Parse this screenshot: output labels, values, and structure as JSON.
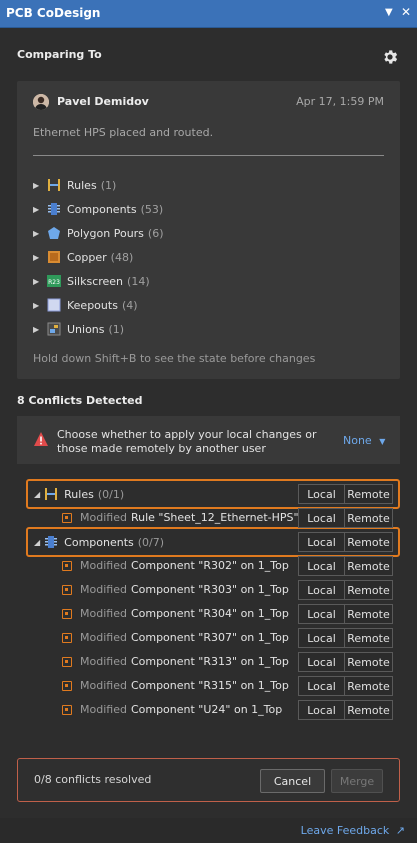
{
  "window": {
    "title": "PCB CoDesign",
    "dropdown_icon": "chevron-down-icon",
    "close_icon": "close-icon"
  },
  "comparing": {
    "heading": "Comparing To",
    "settings_icon": "gear-icon",
    "author": "Pavel Demidov",
    "date": "Apr 17, 1:59 PM",
    "comment": "Ethernet HPS placed and routed.",
    "tree": [
      {
        "label": "Rules",
        "count": "(1)",
        "icon": "rules-icon"
      },
      {
        "label": "Components",
        "count": "(53)",
        "icon": "component-icon"
      },
      {
        "label": "Polygon Pours",
        "count": "(6)",
        "icon": "polygon-icon"
      },
      {
        "label": "Copper",
        "count": "(48)",
        "icon": "copper-icon"
      },
      {
        "label": "Silkscreen",
        "count": "(14)",
        "icon": "silkscreen-icon"
      },
      {
        "label": "Keepouts",
        "count": "(4)",
        "icon": "keepout-icon"
      },
      {
        "label": "Unions",
        "count": "(1)",
        "icon": "union-icon"
      }
    ],
    "hint": "Hold down Shift+B to see the state before changes"
  },
  "conflicts": {
    "heading": "8 Conflicts Detected",
    "info": "Choose whether to apply your local changes or those made remotely by another user",
    "apply_option": "None",
    "local_label": "Local",
    "remote_label": "Remote",
    "groups": [
      {
        "label": "Rules",
        "count": "(0/1)",
        "items": [
          {
            "modified": "Modified",
            "object": "Rule \"Sheet_12_Ethernet-HPS\""
          }
        ]
      },
      {
        "label": "Components",
        "count": "(0/7)",
        "items": [
          {
            "modified": "Modified",
            "object": "Component \"R302\" on 1_Top"
          },
          {
            "modified": "Modified",
            "object": "Component \"R303\" on 1_Top"
          },
          {
            "modified": "Modified",
            "object": "Component \"R304\" on 1_Top"
          },
          {
            "modified": "Modified",
            "object": "Component \"R307\" on 1_Top"
          },
          {
            "modified": "Modified",
            "object": "Component \"R313\" on 1_Top"
          },
          {
            "modified": "Modified",
            "object": "Component \"R315\" on 1_Top"
          },
          {
            "modified": "Modified",
            "object": "Component \"U24\" on 1_Top"
          }
        ]
      }
    ]
  },
  "footer": {
    "resolved": "0/8 conflicts resolved",
    "cancel": "Cancel",
    "merge": "Merge",
    "feedback": "Leave Feedback"
  },
  "colors": {
    "accent": "#3b72b8",
    "highlight": "#e07a1f",
    "link": "#6ea8ea",
    "warning": "#e04b4b"
  }
}
